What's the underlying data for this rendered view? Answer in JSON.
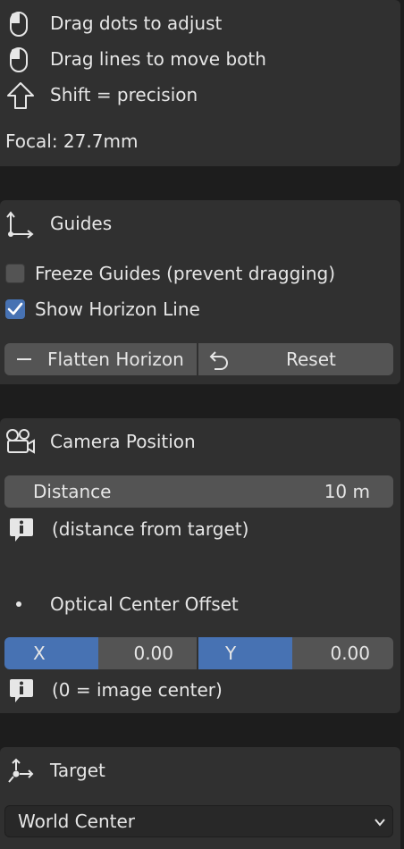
{
  "hints": [
    {
      "icon": "mouse-icon",
      "text": "Drag dots to adjust"
    },
    {
      "icon": "mouse-icon",
      "text": "Drag lines to move both"
    },
    {
      "icon": "shift-arrow-icon",
      "text": "Shift = precision"
    }
  ],
  "focal": "Focal: 27.7mm",
  "guides": {
    "title": "Guides",
    "freeze_label": "Freeze Guides (prevent dragging)",
    "freeze_checked": false,
    "horizon_label": "Show Horizon Line",
    "horizon_checked": true,
    "flatten_label": "Flatten Horizon",
    "reset_label": "Reset"
  },
  "camera": {
    "title": "Camera Position",
    "distance_label": "Distance",
    "distance_value": "10 m",
    "distance_note": "(distance from target)",
    "offset_title": "Optical Center Offset",
    "x_label": "X",
    "x_value": "0.00",
    "y_label": "Y",
    "y_value": "0.00",
    "offset_note": "(0 = image center)"
  },
  "target": {
    "title": "Target",
    "selected": "World Center"
  },
  "colors": {
    "accent": "#4772b3",
    "panel": "#303030",
    "field": "#545454",
    "background": "#1d1d1d"
  }
}
